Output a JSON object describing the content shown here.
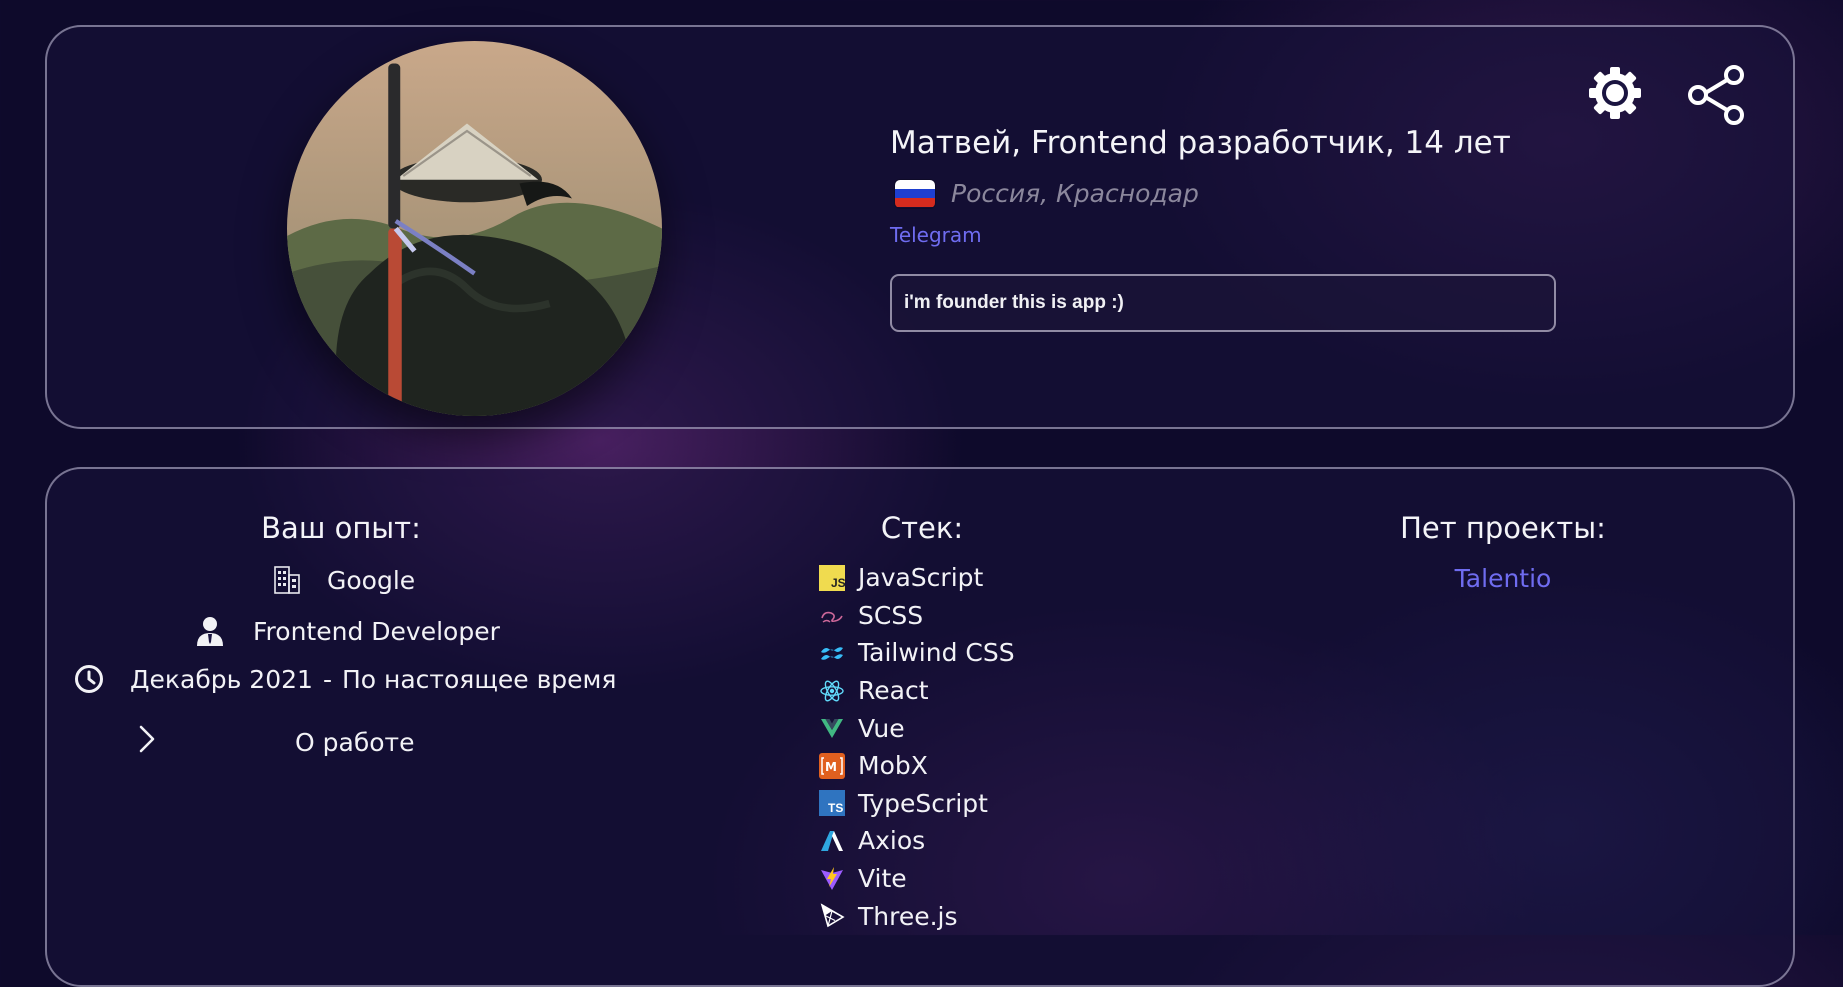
{
  "profile": {
    "name_line": "Матвей, Frontend разработчик, 14 лет",
    "location": "Россия, Краснодар",
    "flag_colors": [
      "#ffffff",
      "#1e3fd0",
      "#d52b1e"
    ],
    "telegram_label": "Telegram",
    "bio": "i'm founder this is app :)",
    "actions": {
      "settings_icon": "gear-icon",
      "share_icon": "share-icon"
    }
  },
  "experience": {
    "title": "Ваш опыт:",
    "company": "Google",
    "position": "Frontend Developer",
    "period_start": "Декабрь 2021",
    "period_separator": "-",
    "period_end": "По настоящее время",
    "about_button": "О работе"
  },
  "stack": {
    "title": "Стек:",
    "items": [
      {
        "label": "JavaScript",
        "icon": "javascript-icon",
        "color": "#f0db4f"
      },
      {
        "label": "SCSS",
        "icon": "sass-icon",
        "color": "#cd6799"
      },
      {
        "label": "Tailwind CSS",
        "icon": "tailwind-icon",
        "color": "#38bdf8"
      },
      {
        "label": "React",
        "icon": "react-icon",
        "color": "#61dafb"
      },
      {
        "label": "Vue",
        "icon": "vue-icon",
        "color": "#41b883"
      },
      {
        "label": "MobX",
        "icon": "mobx-icon",
        "color": "#e0601f"
      },
      {
        "label": "TypeScript",
        "icon": "typescript-icon",
        "color": "#2f74c0"
      },
      {
        "label": "Axios",
        "icon": "axios-icon",
        "color": "#5a29e4"
      },
      {
        "label": "Vite",
        "icon": "vite-icon",
        "color": "#9d5cff"
      },
      {
        "label": "Three.js",
        "icon": "threejs-icon",
        "color": "#ffffff"
      }
    ]
  },
  "pet_projects": {
    "title": "Пет проекты:",
    "items": [
      {
        "label": "Talentio"
      }
    ]
  },
  "colors": {
    "link": "#6f6cf0",
    "background": "#0e0a2b"
  }
}
